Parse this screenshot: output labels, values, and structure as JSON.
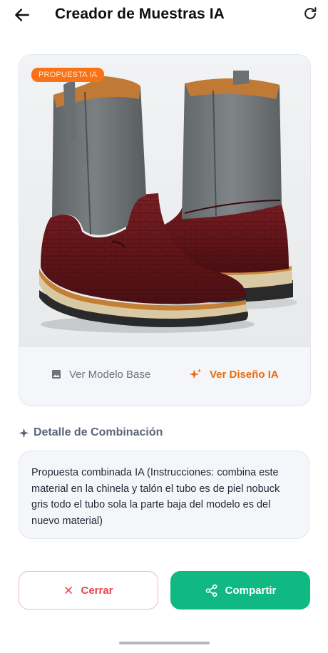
{
  "appbar": {
    "title": "Creador de Muestras IA",
    "back_icon": "arrow-left-icon",
    "refresh_icon": "refresh-icon"
  },
  "preview": {
    "badge": "PROPUESTA IA",
    "image_subject": "pair of western pull-up boots: grey nubuck shaft, burgundy croc-embossed leather vamp and heel, tan sole",
    "view_base_label": "Ver Modelo Base",
    "view_base_icon": "image-icon",
    "view_ia_label": "Ver Diseño IA",
    "view_ia_icon": "sparkle-icon",
    "active_view": "Ver Diseño IA"
  },
  "detail": {
    "title": "Detalle de Combinación",
    "title_icon": "sparkle-icon",
    "text": "Propuesta combinada IA (Instrucciones: combina este material en la chinela y talón el tubo es de piel nobuck gris todo el tubo sola la parte baja del modelo es del nuevo material)"
  },
  "actions": {
    "close_label": "Cerrar",
    "close_icon": "close-icon",
    "share_label": "Compartir",
    "share_icon": "share-icon"
  },
  "colors": {
    "accent_orange": "#ea6b0c",
    "badge_orange": "#f97316",
    "share_green": "#10b981",
    "close_red": "#e5484d",
    "card_bg": "#f4f6f9"
  }
}
